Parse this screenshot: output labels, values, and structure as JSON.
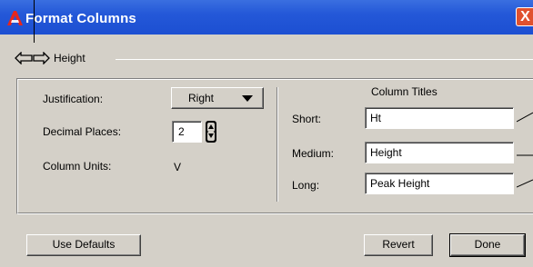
{
  "window": {
    "title": "Format Columns",
    "close_label": "X"
  },
  "header": {
    "column_name": "Height"
  },
  "left": {
    "justification_label": "Justification:",
    "justification_value": "Right",
    "decimal_places_label": "Decimal Places:",
    "decimal_places_value": "2",
    "column_units_label": "Column Units:",
    "column_units_value": "V"
  },
  "titles": {
    "heading": "Column Titles",
    "short_label": "Short:",
    "short_value": "Ht",
    "medium_label": "Medium:",
    "medium_value": "Height",
    "long_label": "Long:",
    "long_value": "Peak Height"
  },
  "buttons": {
    "use_defaults": "Use Defaults",
    "revert": "Revert",
    "done": "Done"
  },
  "colors": {
    "titlebar": "#2458d8",
    "dialog_bg": "#d4d0c8",
    "close": "#e0512f"
  }
}
